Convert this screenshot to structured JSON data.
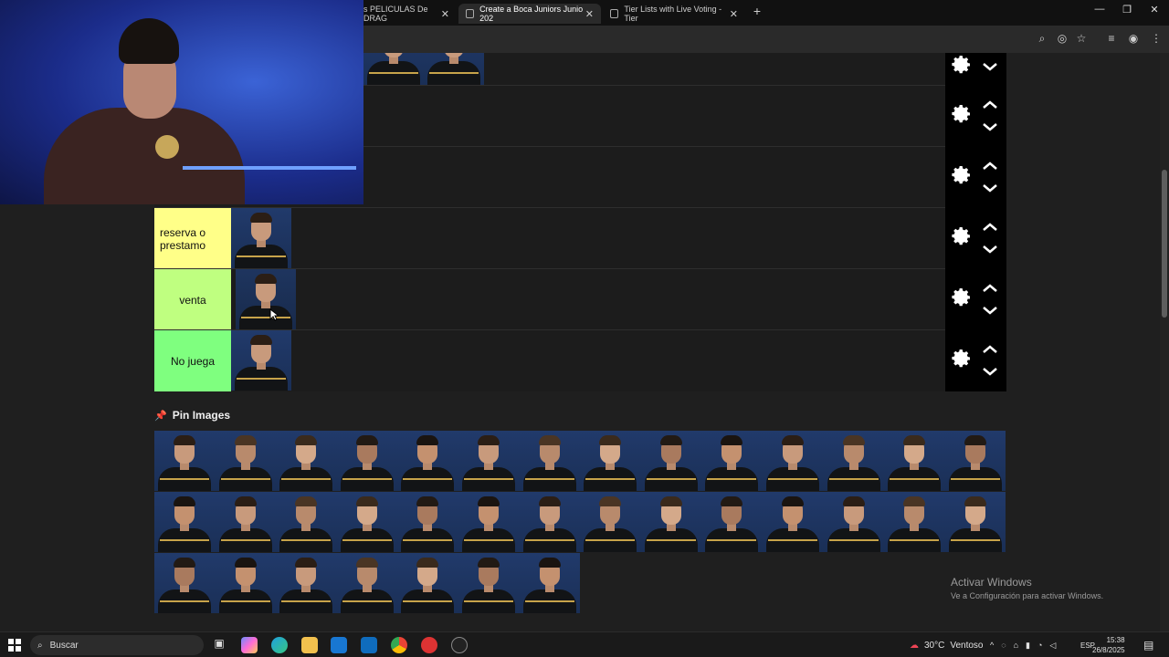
{
  "browser": {
    "tabs": [
      {
        "label": "s PELICULAS De DRAG",
        "active": false
      },
      {
        "label": "Create a Boca Juniors Junio 202",
        "active": true
      },
      {
        "label": "Tier Lists with Live Voting - Tier",
        "active": false
      }
    ]
  },
  "tiers": [
    {
      "label": "",
      "color": "#1c1c1c",
      "items": 0
    },
    {
      "label": "",
      "color": "#1c1c1c",
      "items": 0
    },
    {
      "label": "reserva o prestamo",
      "color": "#ffff88",
      "items": 1
    },
    {
      "label": "venta",
      "color": "#bfff80",
      "items": 1
    },
    {
      "label": "No juega",
      "color": "#7fff7f",
      "items": 1
    }
  ],
  "pin_section": {
    "title": "Pin Images"
  },
  "pool_rows": [
    14,
    14,
    7
  ],
  "watermark": {
    "line1": "Activar Windows",
    "line2": "Ve a Configuración para activar Windows."
  },
  "taskbar": {
    "search_placeholder": "Buscar",
    "weather": "30°C",
    "weather_desc": "Ventoso",
    "lang": "ESP",
    "time": "15:38",
    "date": "26/8/2025"
  }
}
